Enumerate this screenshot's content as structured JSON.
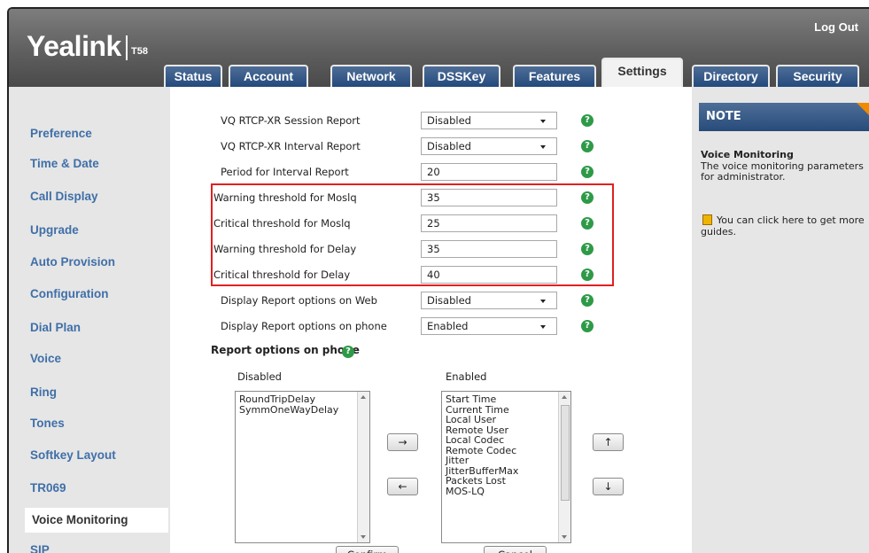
{
  "header": {
    "logo": "Yealink",
    "model": "T58",
    "logout": "Log Out"
  },
  "tabs": [
    {
      "label": "Status",
      "active": false
    },
    {
      "label": "Account",
      "active": false
    },
    {
      "label": "Network",
      "active": false
    },
    {
      "label": "DSSKey",
      "active": false
    },
    {
      "label": "Features",
      "active": false
    },
    {
      "label": "Settings",
      "active": true
    },
    {
      "label": "Directory",
      "active": false
    },
    {
      "label": "Security",
      "active": false
    }
  ],
  "sidebar": {
    "items": [
      {
        "label": "Preference",
        "active": false
      },
      {
        "label": "Time & Date",
        "active": false
      },
      {
        "label": "Call Display",
        "active": false
      },
      {
        "label": "Upgrade",
        "active": false
      },
      {
        "label": "Auto Provision",
        "active": false
      },
      {
        "label": "Configuration",
        "active": false
      },
      {
        "label": "Dial Plan",
        "active": false
      },
      {
        "label": "Voice",
        "active": false
      },
      {
        "label": "Ring",
        "active": false
      },
      {
        "label": "Tones",
        "active": false
      },
      {
        "label": "Softkey Layout",
        "active": false
      },
      {
        "label": "TR069",
        "active": false
      },
      {
        "label": "Voice Monitoring",
        "active": true
      },
      {
        "label": "SIP",
        "active": false
      }
    ]
  },
  "form": {
    "rows": [
      {
        "label": "VQ RTCP-XR Session Report",
        "type": "select",
        "value": "Disabled"
      },
      {
        "label": "VQ RTCP-XR Interval Report",
        "type": "select",
        "value": "Disabled"
      },
      {
        "label": "Period for Interval Report",
        "type": "input",
        "value": "20"
      },
      {
        "label": "Warning threshold for Moslq",
        "type": "input",
        "value": "35"
      },
      {
        "label": "Critical threshold for Moslq",
        "type": "input",
        "value": "25"
      },
      {
        "label": "Warning threshold for Delay",
        "type": "input",
        "value": "35"
      },
      {
        "label": "Critical threshold for Delay",
        "type": "input",
        "value": "40"
      },
      {
        "label": "Display Report options on Web",
        "type": "select",
        "value": "Disabled"
      },
      {
        "label": "Display Report options on phone",
        "type": "select",
        "value": "Enabled"
      }
    ],
    "help_glyph": "?",
    "highlight_color": "#e02020"
  },
  "report_options": {
    "title": "Report options on phone",
    "disabled_label": "Disabled",
    "enabled_label": "Enabled",
    "disabled_items": [
      "RoundTripDelay",
      "SymmOneWayDelay"
    ],
    "enabled_items": [
      "Start Time",
      "Current Time",
      "Local User",
      "Remote User",
      "Local Codec",
      "Remote Codec",
      "Jitter",
      "JitterBufferMax",
      "Packets Lost",
      "MOS-LQ"
    ],
    "move_right": "→",
    "move_left": "←",
    "move_up": "↑",
    "move_down": "↓",
    "confirm": "Confirm",
    "cancel": "Cancel"
  },
  "note": {
    "heading": "NOTE",
    "title": "Voice Monitoring",
    "description": "The voice monitoring parameters for administrator.",
    "guide": "You can click here to get more guides.",
    "accent_color": "#f08a00"
  },
  "colors": {
    "tab": "#2f5585",
    "sidebar_link": "#3f6fa8",
    "help": "#2e9a48"
  }
}
